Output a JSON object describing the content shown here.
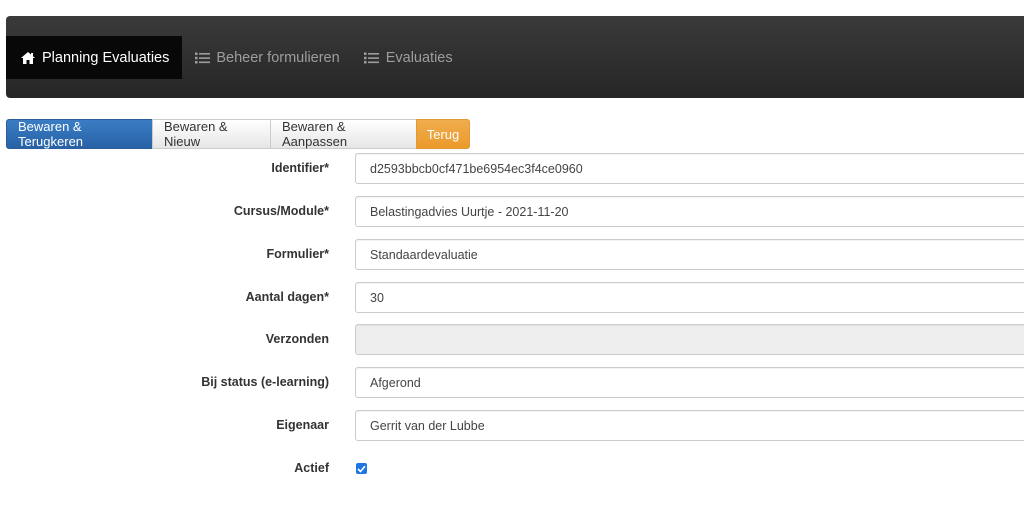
{
  "nav": {
    "items": [
      {
        "label": "Planning Evaluaties",
        "icon": "home-icon",
        "active": true
      },
      {
        "label": "Beheer formulieren",
        "icon": "list-icon",
        "active": false
      },
      {
        "label": "Evaluaties",
        "icon": "list-icon",
        "active": false
      }
    ]
  },
  "toolbar": {
    "save_return": "Bewaren & Terugkeren",
    "save_new": "Bewaren & Nieuw",
    "save_edit": "Bewaren & Aanpassen",
    "back": "Terug"
  },
  "form": {
    "identifier": {
      "label": "Identifier*",
      "value": "d2593bbcb0cf471be6954ec3f4ce0960"
    },
    "course": {
      "label": "Cursus/Module*",
      "value": "Belastingadvies Uurtje - 2021-11-20"
    },
    "form": {
      "label": "Formulier*",
      "value": "Standaardevaluatie"
    },
    "days": {
      "label": "Aantal dagen*",
      "value": "30"
    },
    "sent": {
      "label": "Verzonden",
      "value": ""
    },
    "status": {
      "label": "Bij status (e-learning)",
      "value": "Afgerond"
    },
    "owner": {
      "label": "Eigenaar",
      "value": "Gerrit van der Lubbe"
    },
    "active": {
      "label": "Actief",
      "checked": true
    }
  },
  "colors": {
    "navbar": "#2f2f2f",
    "primary": "#2f6eb5",
    "warning": "#f0ad4e",
    "checkbox": "#1f75e4"
  }
}
